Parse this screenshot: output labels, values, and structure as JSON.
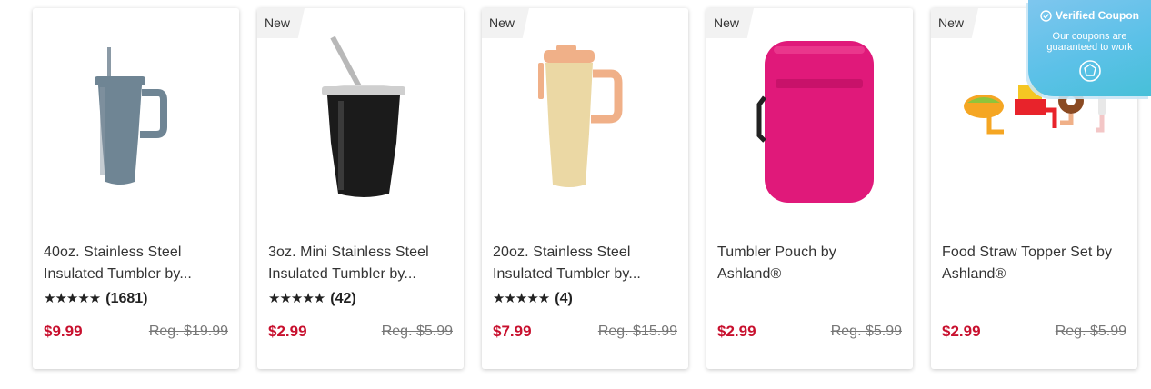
{
  "products": [
    {
      "badge": "",
      "title_line1": "40oz. Stainless Steel",
      "title_line2": "Insulated Tumbler by...",
      "stars": "★★★★★",
      "reviews": "(1681)",
      "price": "$9.99",
      "reg_price": "Reg. $19.99",
      "image_icon": "tumbler-40oz-icon",
      "color": "#6f8594"
    },
    {
      "badge": "New",
      "title_line1": "3oz. Mini Stainless Steel",
      "title_line2": "Insulated Tumbler by...",
      "stars": "★★★★★",
      "reviews": "(42)",
      "price": "$2.99",
      "reg_price": "Reg. $5.99",
      "image_icon": "mini-tumbler-icon",
      "color": "#1b1b1b"
    },
    {
      "badge": "New",
      "title_line1": "20oz. Stainless Steel",
      "title_line2": "Insulated Tumbler by...",
      "stars": "★★★★★",
      "reviews": "(4)",
      "price": "$7.99",
      "reg_price": "Reg. $15.99",
      "image_icon": "tumbler-20oz-icon",
      "color": "#ebd8a4"
    },
    {
      "badge": "New",
      "title_line1": "Tumbler Pouch by",
      "title_line2": "Ashland®",
      "stars": "",
      "reviews": "",
      "price": "$2.99",
      "reg_price": "Reg. $5.99",
      "image_icon": "pouch-icon",
      "color": "#e0197a"
    },
    {
      "badge": "New",
      "title_line1": "Food Straw Topper Set by",
      "title_line2": "Ashland®",
      "stars": "",
      "reviews": "",
      "price": "$2.99",
      "reg_price": "Reg. $5.99",
      "image_icon": "straw-topper-icon",
      "color": "#f5a623"
    }
  ],
  "coupon": {
    "title": "Verified Coupon",
    "line1": "Our coupons are",
    "line2": "guaranteed to work",
    "icon": "badge-icon"
  },
  "colors": {
    "price": "#c8102e",
    "coupon_bg": "#5cc1e8"
  }
}
